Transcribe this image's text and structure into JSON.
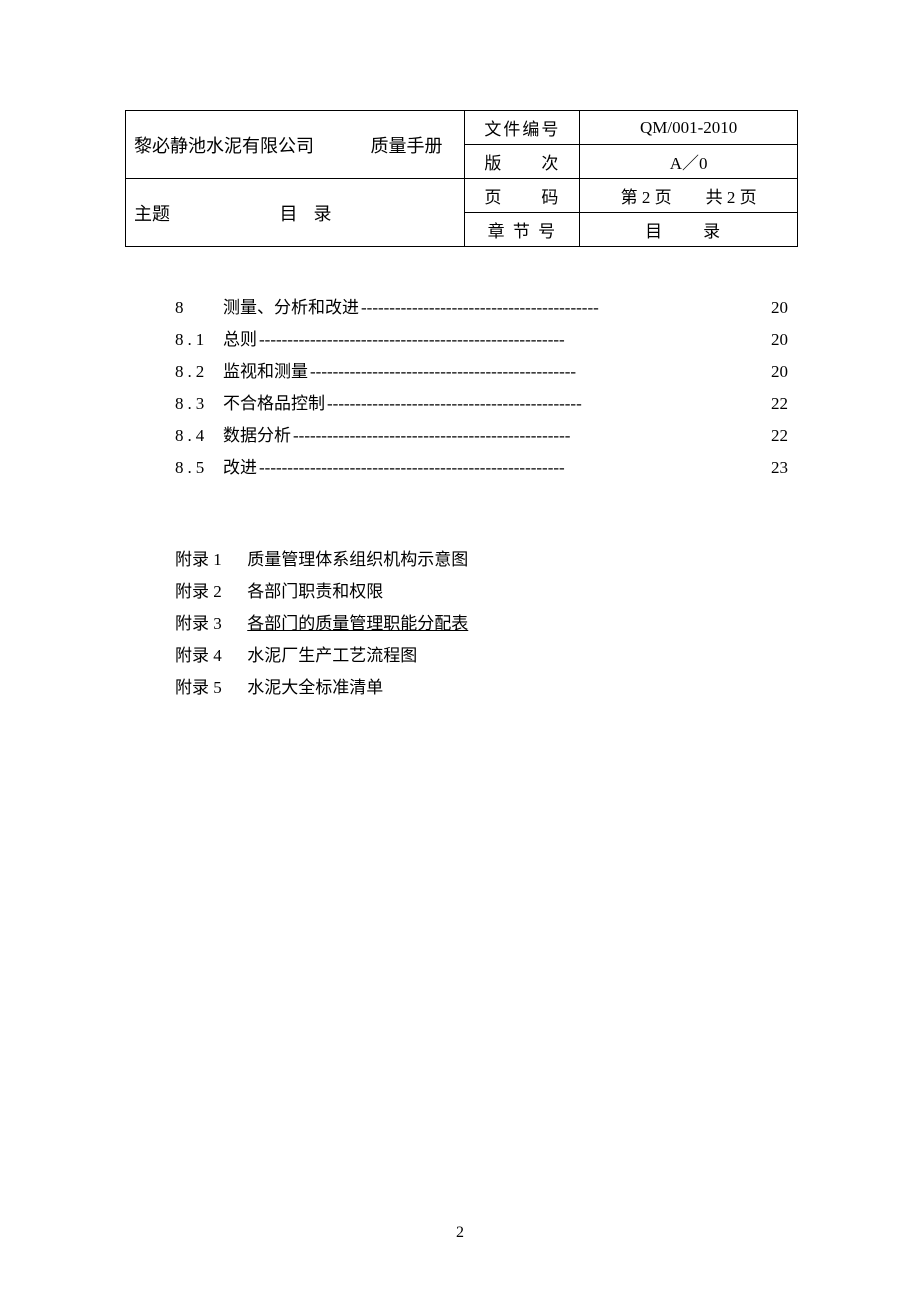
{
  "header": {
    "company": "黎必静池水泥有限公司",
    "manual": "质量手册",
    "topic_label": "主题",
    "topic_value": "目录",
    "fields": {
      "doc_no_label": "文件编号",
      "doc_no_value": "QM/001-2010",
      "version_label": "版　　次",
      "version_value": "A／0",
      "page_label": "页　　码",
      "page_value": "第 2 页　　共 2 页",
      "section_label": "章 节 号",
      "section_value": "目　录"
    }
  },
  "toc": [
    {
      "num": "8",
      "title": "测量、分析和改进",
      "page": "20"
    },
    {
      "num": "8.1",
      "title": "总则",
      "page": "20"
    },
    {
      "num": "8.2",
      "title": "监视和测量",
      "page": "20"
    },
    {
      "num": "8.3",
      "title": "不合格品控制",
      "page": "22"
    },
    {
      "num": "8.4",
      "title": "数据分析",
      "page": "22"
    },
    {
      "num": "8.5",
      "title": "改进",
      "page": "23"
    }
  ],
  "appendix": [
    {
      "num": "附录 1",
      "title": "质量管理体系组织机构示意图",
      "underline": false
    },
    {
      "num": "附录 2",
      "title": "各部门职责和权限",
      "underline": false
    },
    {
      "num": "附录 3",
      "title": "各部门的质量管理职能分配表",
      "underline": true
    },
    {
      "num": "附录 4",
      "title": "水泥厂生产工艺流程图",
      "underline": false
    },
    {
      "num": "附录 5",
      "title": "水泥大全标准清单",
      "underline": false
    }
  ],
  "footer_page": "2"
}
